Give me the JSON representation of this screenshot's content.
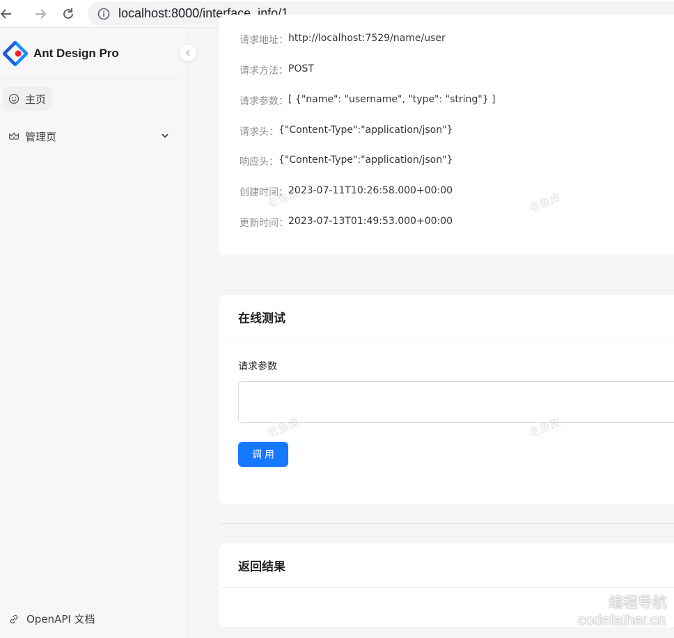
{
  "browser": {
    "url": "localhost:8000/interface_info/1"
  },
  "sidebar": {
    "logo_text": "Ant Design Pro",
    "items": [
      {
        "label": "主页",
        "icon": "smile-icon"
      },
      {
        "label": "管理页",
        "icon": "crown-icon"
      }
    ],
    "footer_link": "OpenAPI 文档"
  },
  "details": [
    {
      "key": "请求地址：",
      "value": "http://localhost:7529/name/user"
    },
    {
      "key": "请求方法：",
      "value": "POST"
    },
    {
      "key": "请求参数：",
      "value": "[ {\"name\": \"username\", \"type\": \"string\"} ]"
    },
    {
      "key": "请求头：",
      "value": "{\"Content-Type\":\"application/json\"}"
    },
    {
      "key": "响应头：",
      "value": "{\"Content-Type\":\"application/json\"}"
    },
    {
      "key": "创建时间：",
      "value": "2023-07-11T10:26:58.000+00:00"
    },
    {
      "key": "更新时间：",
      "value": "2023-07-13T01:49:53.000+00:00"
    }
  ],
  "test_card": {
    "title": "在线测试",
    "field_label": "请求参数",
    "field_value": "",
    "button_label": "调用"
  },
  "result_card": {
    "title": "返回结果"
  },
  "watermark": "老鱼皮",
  "corner_mark": {
    "cn": "编程导航",
    "en": "codefather.cn"
  },
  "colors": {
    "primary": "#1677ff",
    "logo_red": "#f5222d",
    "logo_blue": "#1890ff"
  }
}
